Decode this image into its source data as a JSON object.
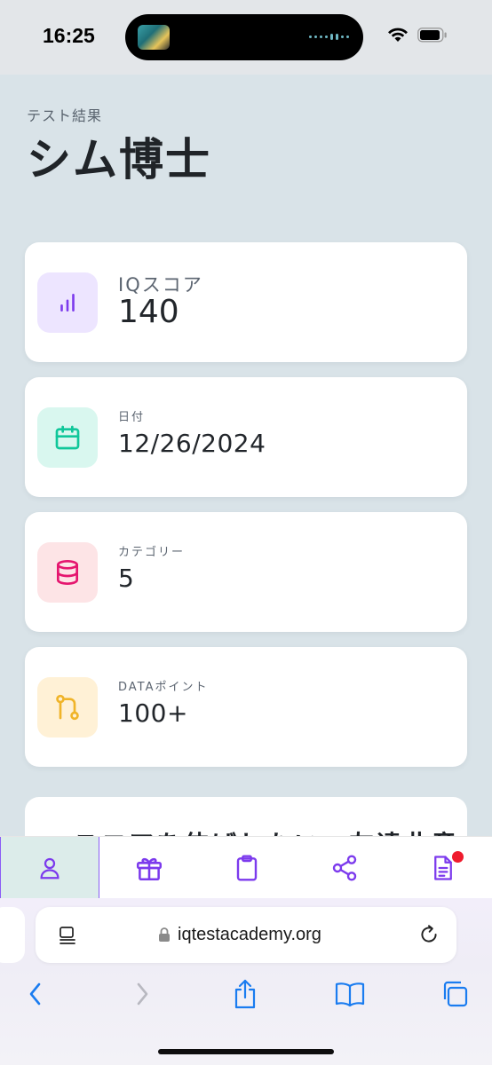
{
  "status_bar": {
    "time": "16:25"
  },
  "header": {
    "subtitle": "テスト結果",
    "title": "シム博士"
  },
  "cards": [
    {
      "label": "IQスコア",
      "value": "140",
      "icon": "bar-chart-icon",
      "icon_bg": "#ede5ff",
      "icon_color": "#7c3aed"
    },
    {
      "label": "日付",
      "value": "12/26/2024",
      "icon": "calendar-icon",
      "icon_bg": "#d9f7ef",
      "icon_color": "#10c79a"
    },
    {
      "label": "カテゴリー",
      "value": "5",
      "icon": "database-icon",
      "icon_bg": "#fde4e6",
      "icon_color": "#e5166f"
    },
    {
      "label": "DATAポイント",
      "value": "100+",
      "icon": "git-pull-request-icon",
      "icon_bg": "#fff1d6",
      "icon_color": "#f0b429"
    }
  ],
  "partial_card": {
    "text": "スコアを伸ばしたい…友達此意"
  },
  "tab_bar": {
    "tabs": [
      {
        "name": "user-icon",
        "active": true
      },
      {
        "name": "gift-icon",
        "active": false
      },
      {
        "name": "clipboard-icon",
        "active": false
      },
      {
        "name": "share-icon",
        "active": false
      },
      {
        "name": "document-icon",
        "active": false,
        "badge": true
      }
    ],
    "accent": "#7c3aed"
  },
  "browser": {
    "url": "iqtestacademy.org",
    "accent": "#1a7cf0"
  }
}
